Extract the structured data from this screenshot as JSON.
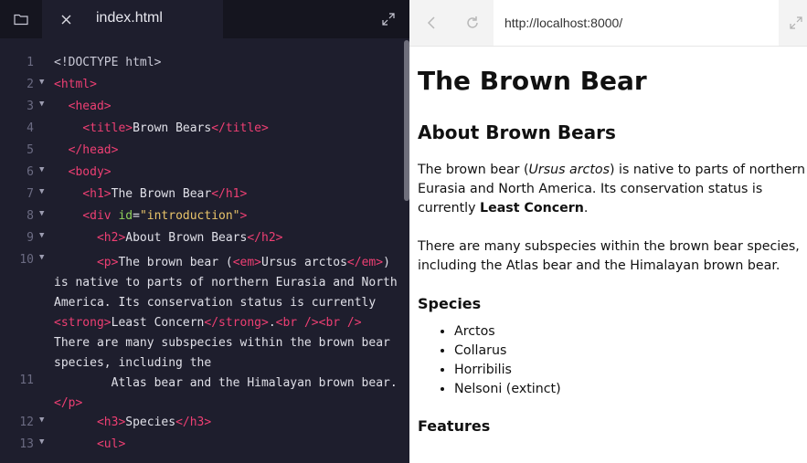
{
  "editor": {
    "tab": {
      "filename": "index.html"
    },
    "icons": {
      "files": "folder-icon",
      "close": "close-icon",
      "expand": "expand-icon"
    },
    "colors": {
      "tag": "#ee3f73",
      "attribute": "#8fd15b",
      "string": "#e9c46a",
      "text": "#e0e0e8",
      "background": "#1e1e2d"
    }
  },
  "browser": {
    "url": "http://localhost:8000/",
    "icons": {
      "back": "back-arrow-icon",
      "reload": "reload-icon",
      "expand": "expand-icon"
    },
    "page": {
      "h1": "The Brown Bear",
      "h2": "About Brown Bears",
      "p1": {
        "before": "The brown bear (",
        "em": "Ursus arctos",
        "middle": ") is native to parts of northern Eurasia and North America. Its conservation status is currently ",
        "strong": "Least Concern",
        "after": "."
      },
      "p2": "There are many subspecies within the brown bear species, including the Atlas bear and the Himalayan brown bear.",
      "h3_species": "Species",
      "species": [
        "Arctos",
        "Collarus",
        "Horribilis",
        "Nelsoni (extinct)"
      ],
      "h3_features": "Features"
    }
  }
}
